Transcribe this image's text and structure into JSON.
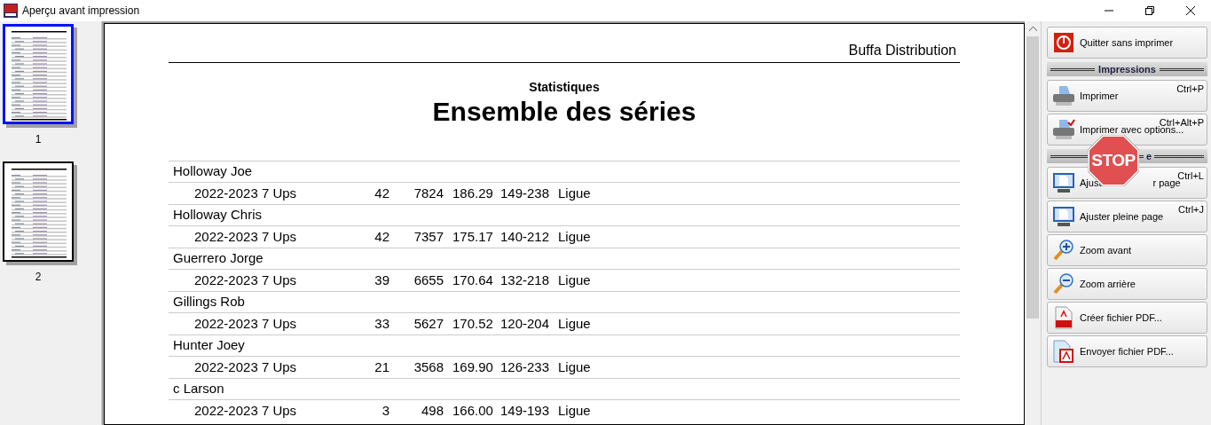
{
  "window": {
    "title": "Aperçu avant impression"
  },
  "thumbnails": [
    {
      "label": "1",
      "selected": true
    },
    {
      "label": "2",
      "selected": false
    }
  ],
  "report": {
    "company": "Buffa Distribution",
    "subtitle": "Statistiques",
    "title": "Ensemble des séries",
    "records": [
      {
        "name": "Holloway Joe",
        "season": "2022-2023 7 Ups",
        "games": "42",
        "pins": "7824",
        "average": "186.29",
        "range": "149-238",
        "type": "Ligue"
      },
      {
        "name": "Holloway Chris",
        "season": "2022-2023 7 Ups",
        "games": "42",
        "pins": "7357",
        "average": "175.17",
        "range": "140-212",
        "type": "Ligue"
      },
      {
        "name": "Guerrero Jorge",
        "season": "2022-2023 7 Ups",
        "games": "39",
        "pins": "6655",
        "average": "170.64",
        "range": "132-218",
        "type": "Ligue"
      },
      {
        "name": "Gillings Rob",
        "season": "2022-2023 7 Ups",
        "games": "33",
        "pins": "5627",
        "average": "170.52",
        "range": "120-204",
        "type": "Ligue"
      },
      {
        "name": "Hunter Joey",
        "season": "2022-2023 7 Ups",
        "games": "21",
        "pins": "3568",
        "average": "169.90",
        "range": "126-233",
        "type": "Ligue"
      },
      {
        "name": "c Larson",
        "season": "2022-2023 7 Ups",
        "games": "3",
        "pins": "498",
        "average": "166.00",
        "range": "149-193",
        "type": "Ligue"
      }
    ]
  },
  "panel": [
    {
      "kind": "exit",
      "label": "Quitter sans imprimer"
    },
    {
      "kind": "header",
      "label": "Impressions"
    },
    {
      "kind": "printer",
      "label": "Imprimer",
      "shortcut": "Ctrl+P"
    },
    {
      "kind": "printer-options",
      "label": "Imprimer avec options...",
      "shortcut": "Ctrl+Alt+P"
    },
    {
      "kind": "partial-header",
      "label": "e"
    },
    {
      "kind": "monitor",
      "label": "Ajust",
      "label_after": "r page",
      "shortcut": "Ctrl+L"
    },
    {
      "kind": "monitor",
      "label": "Ajuster pleine page",
      "shortcut": "Ctrl+J"
    },
    {
      "kind": "zoom-in",
      "label": "Zoom avant"
    },
    {
      "kind": "zoom-out",
      "label": "Zoom arrière"
    },
    {
      "kind": "pdf",
      "label": "Créer fichier PDF..."
    },
    {
      "kind": "pdf-send",
      "label": "Envoyer fichier PDF..."
    }
  ],
  "stop_sign": {
    "label": "STOP"
  }
}
